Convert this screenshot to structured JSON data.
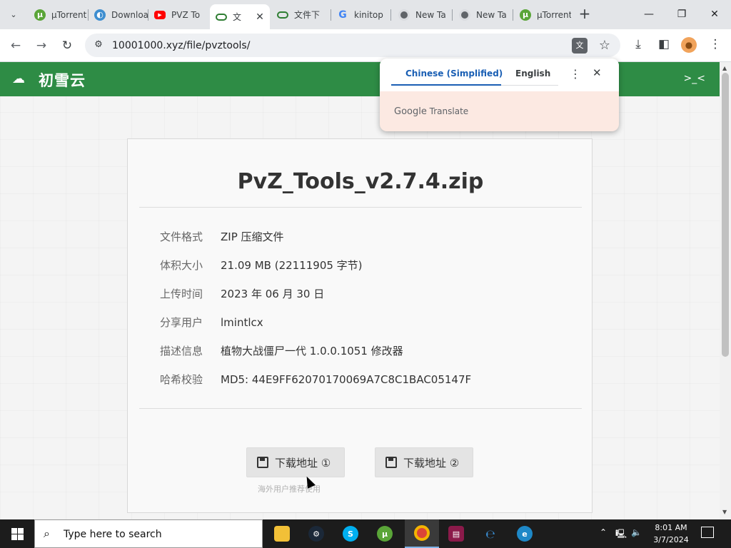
{
  "browser": {
    "tabs": [
      {
        "label": "µTorrent",
        "icon": "utorrent-icon"
      },
      {
        "label": "Download",
        "icon": "download-site-icon"
      },
      {
        "label": "PVZ To",
        "icon": "youtube-icon"
      },
      {
        "label": "文",
        "icon": "cloud-icon",
        "active": true
      },
      {
        "label": "文件下",
        "icon": "cloud-icon"
      },
      {
        "label": "kinitop",
        "icon": "google-icon"
      },
      {
        "label": "New Ta",
        "icon": "chrome-icon"
      },
      {
        "label": "New Ta",
        "icon": "chrome-icon"
      },
      {
        "label": "µTorrent",
        "icon": "utorrent-icon"
      }
    ],
    "url": "10001000.xyz/file/pvztools/"
  },
  "translate_popup": {
    "source_lang": "Chinese (Simplified)",
    "target_lang": "English",
    "brand": "Translate",
    "brand_google": "Google"
  },
  "site": {
    "name": "初雪云",
    "right_text": ">_<"
  },
  "file": {
    "title": "PvZ_Tools_v2.7.4.zip",
    "rows": [
      {
        "label": "文件格式",
        "value": "ZIP 压缩文件"
      },
      {
        "label": "体积大小",
        "value": "21.09 MB (22111905 字节)"
      },
      {
        "label": "上传时间",
        "value": "2023 年 06 月 30 日"
      },
      {
        "label": "分享用户",
        "value": "lmintlcx"
      },
      {
        "label": "描述信息",
        "value": "植物大战僵尸一代 1.0.0.1051 修改器"
      },
      {
        "label": "哈希校验",
        "value": "MD5: 44E9FF62070170069A7C8C1BAC05147F"
      }
    ],
    "download_buttons": [
      {
        "label": "下载地址 ①"
      },
      {
        "label": "下载地址 ②"
      }
    ],
    "download_note": "海外用户推荐使用"
  },
  "taskbar": {
    "search_placeholder": "Type here to search",
    "time": "8:01 AM",
    "date": "3/7/2024"
  }
}
